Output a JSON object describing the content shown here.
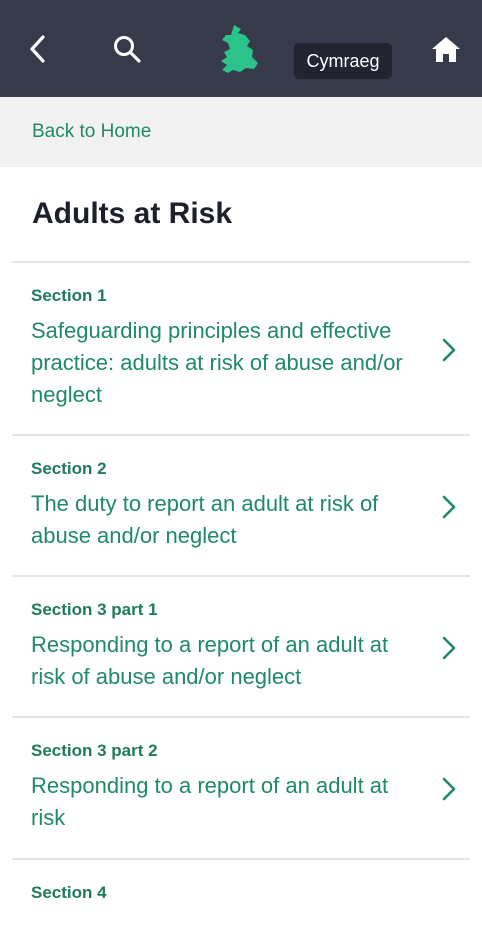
{
  "header": {
    "back_icon": "chevron-left-icon",
    "search_icon": "search-icon",
    "logo": "wales-map-logo",
    "language_label": "Cymraeg",
    "home_icon": "home-icon",
    "colors": {
      "bar": "#373a4a",
      "accent": "#2bc28b"
    }
  },
  "back_link": "Back to Home",
  "page_title": "Adults at Risk",
  "sections": [
    {
      "label": "Section 1",
      "title": "Safeguarding principles and effective practice: adults at risk of abuse and/or neglect"
    },
    {
      "label": "Section 2",
      "title": "The duty to report an adult at risk of abuse and/or neglect"
    },
    {
      "label": "Section 3 part 1",
      "title": "Responding to a report of an adult at risk of abuse and/or neglect"
    },
    {
      "label": "Section 3 part 2",
      "title": "Responding to a report of an adult at risk"
    },
    {
      "label": "Section 4",
      "title": ""
    }
  ]
}
